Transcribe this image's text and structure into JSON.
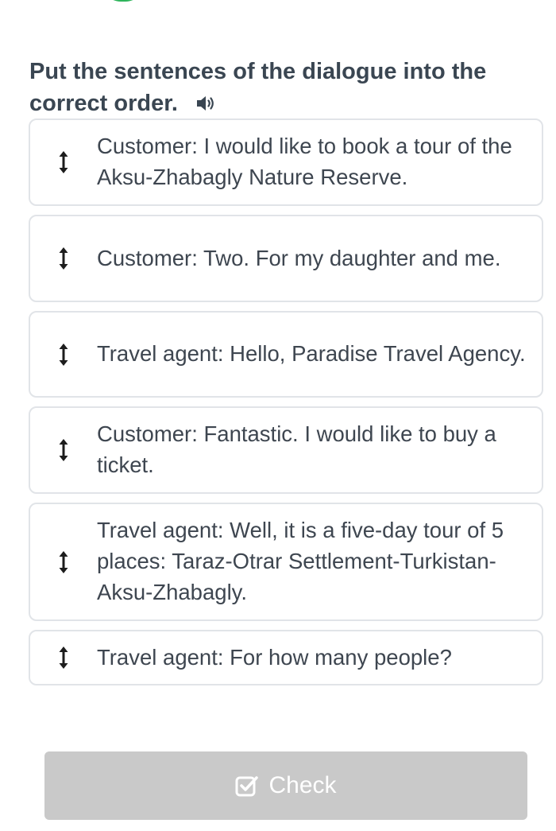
{
  "instruction": {
    "text": "Put the sentences of the dialogue into the correct order."
  },
  "items": [
    {
      "text": "Customer: I would like to book a tour of the Aksu-Zhabagly Nature Reserve."
    },
    {
      "text": "Customer: Two. For my daughter and me."
    },
    {
      "text": "Travel agent: Hello, Paradise Travel Agency."
    },
    {
      "text": "Customer: Fantastic. I would like to buy a ticket."
    },
    {
      "text": "Travel agent: Well, it is a five-day tour of 5 places: Taraz-Otrar Settlement-Turkistan-Aksu-Zhabagly."
    },
    {
      "text": "Travel agent: For how many people?"
    }
  ],
  "check_button": {
    "label": "Check",
    "icon": "checkbox-check-icon"
  },
  "icons": {
    "handle": "drag-handle-icon",
    "speaker": "speaker-icon"
  },
  "colors": {
    "progress": "#2eb45b",
    "button_disabled": "#c9c9c9",
    "title": "#3a4652",
    "border": "#e1e4e8"
  }
}
